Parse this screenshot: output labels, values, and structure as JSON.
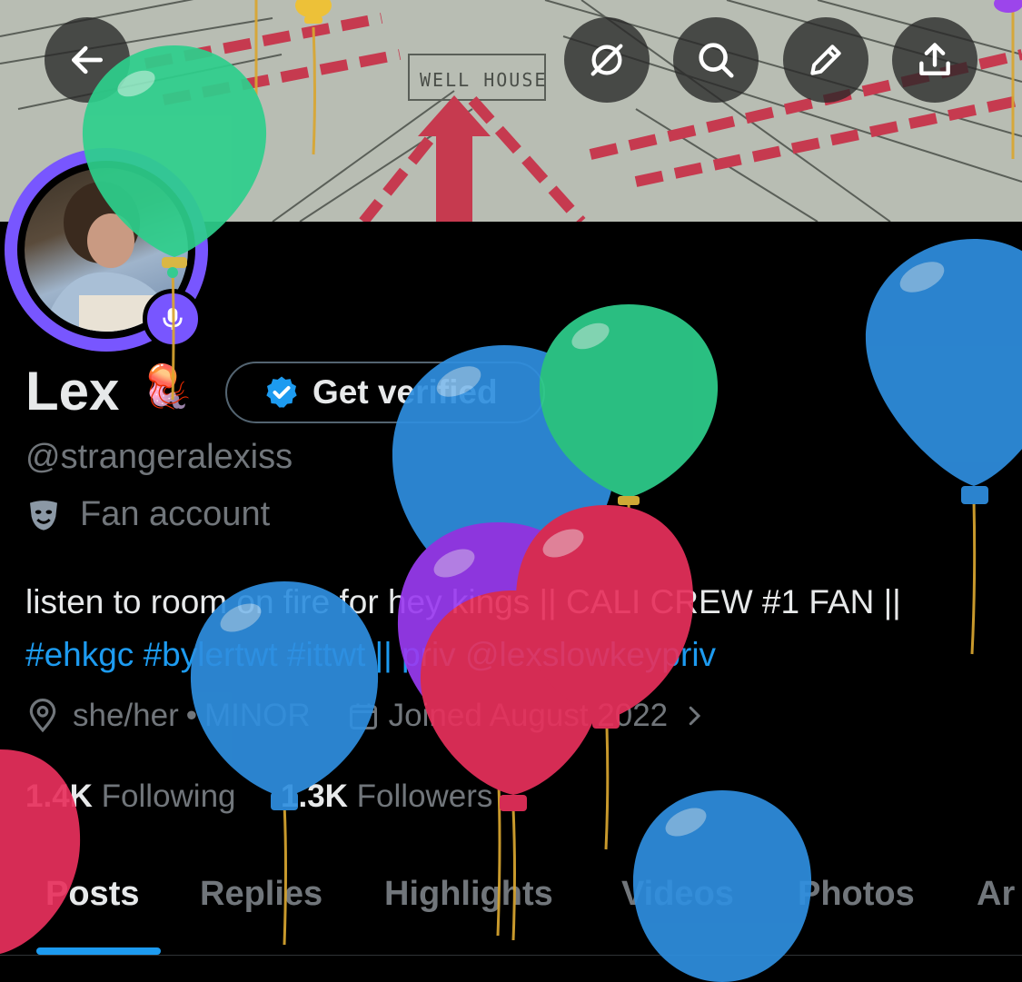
{
  "header": {
    "banner_text": "WELL HOUSE",
    "back_icon": "arrow-left-icon",
    "buttons": [
      "grok-icon",
      "search-icon",
      "edit-icon",
      "share-icon"
    ]
  },
  "profile": {
    "name": "Lex",
    "name_emoji": "🪼",
    "verify_label": "Get verified",
    "handle": "@strangeralexiss",
    "category": "Fan account",
    "bio_text": "listen to room on fire for hey kings || CALI CREW #1 FAN ||",
    "bio_links": "#ehkgc #bylertwt #ittwt || priv @lexslowkeypriv",
    "pronouns": "she/her",
    "minor": "MINOR",
    "joined": "Joined August 2022",
    "following_count": "1.4K",
    "following_label": "Following",
    "followers_count": "1.3K",
    "followers_label": "Followers"
  },
  "tabs": [
    {
      "label": "Posts",
      "active": true
    },
    {
      "label": "Replies"
    },
    {
      "label": "Highlights"
    },
    {
      "label": "Videos"
    },
    {
      "label": "Photos"
    },
    {
      "label": "Ar"
    }
  ],
  "colors": {
    "accent": "#1d9bf0",
    "spaces_purple": "#7856ff",
    "muted": "#71767b",
    "balloon_green": "#2ecf8c",
    "balloon_blue": "#2f8fe0",
    "balloon_pink": "#e8305c",
    "balloon_purple": "#9a3bf0"
  }
}
